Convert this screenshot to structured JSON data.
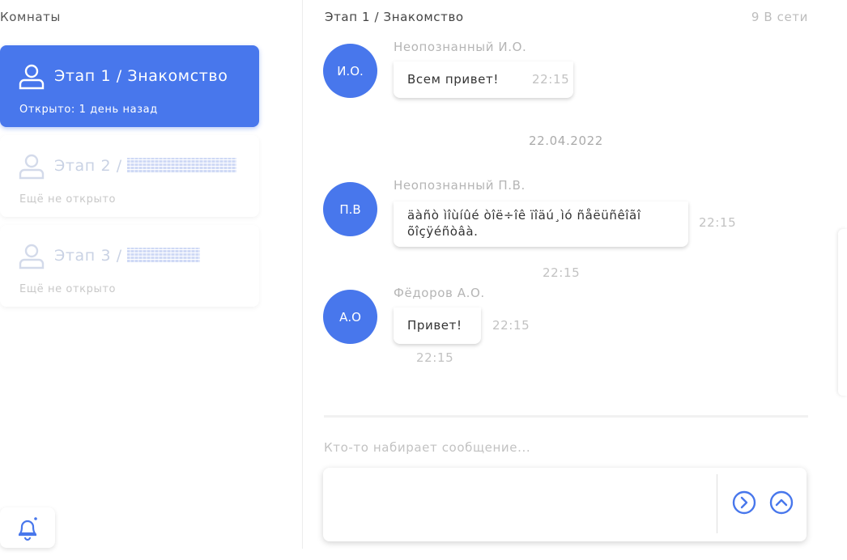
{
  "sidebar": {
    "title": "Комнаты",
    "rooms": [
      {
        "name": "Этап 1 / Знакомство",
        "status": "Открыто: 1 день назад",
        "active": true
      },
      {
        "name_prefix": "Этап 2 /",
        "status": "Ещё не открыто",
        "active": false
      },
      {
        "name_prefix": "Этап 3 /",
        "status": "Ещё не открыто",
        "active": false
      }
    ]
  },
  "chat": {
    "title": "Этап 1 / Знакомство",
    "online": "9 В сети",
    "date_separator": "22.04.2022",
    "typing": "Кто-то набирает сообщение...",
    "messages": [
      {
        "avatar": "И.О.",
        "sender": "Неопознанный И.О.",
        "text": "Всем привет!",
        "time": "22:15"
      },
      {
        "avatar": "П.В",
        "sender": "Неопознанный П.В.",
        "text": "äàñò ìîùíûé òîë÷îê ïîäú¸ìó ñåëüñêîãî õîçÿéñòâà.",
        "time": "22:15",
        "time_below": "22:15"
      },
      {
        "avatar": "А.О",
        "sender": "Фёдоров А.О.",
        "text": "Привет!",
        "time": "22:15",
        "time_below": "22:15"
      }
    ]
  },
  "icons": {
    "room": "person-icon",
    "bell": "bell-icon",
    "send": "chevron-right-circle-icon",
    "up": "chevron-up-circle-icon"
  },
  "colors": {
    "accent": "#4877ec"
  }
}
